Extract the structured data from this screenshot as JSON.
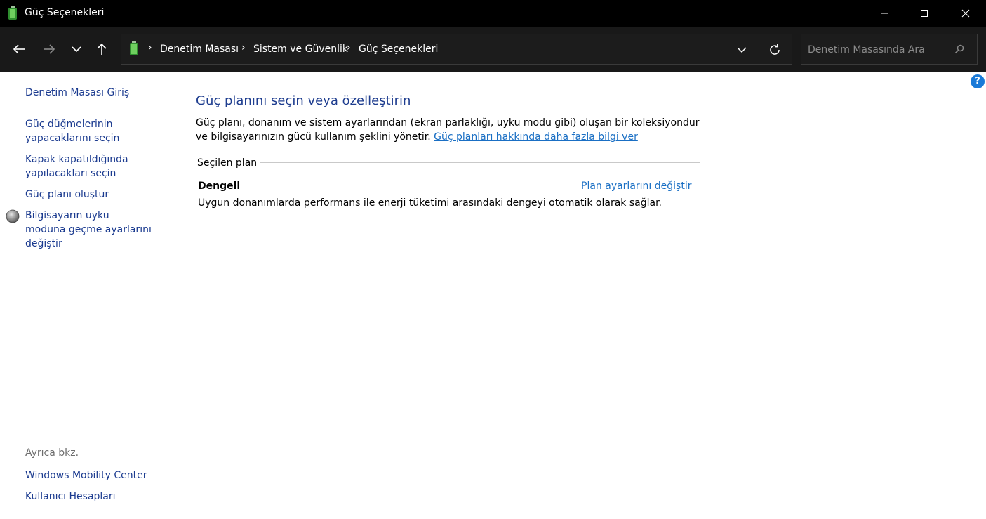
{
  "window": {
    "title": "Güç Seçenekleri"
  },
  "address_bar": {
    "breadcrumbs": [
      "Denetim Masası",
      "Sistem ve Güvenlik",
      "Güç Seçenekleri"
    ],
    "separator": "›"
  },
  "search": {
    "placeholder": "Denetim Masasında Ara"
  },
  "sidebar": {
    "home_link": "Denetim Masası Giriş",
    "tasks": [
      "Güç düğmelerinin yapacaklarını seçin",
      "Kapak kapatıldığında yapılacakları seçin",
      "Güç planı oluştur",
      "Bilgisayarın uyku moduna geçme ayarlarını değiştir"
    ],
    "see_also_label": "Ayrıca bkz.",
    "see_also": [
      "Windows Mobility Center",
      "Kullanıcı Hesapları"
    ]
  },
  "main": {
    "heading": "Güç planını seçin veya özelleştirin",
    "description": "Güç planı, donanım ve sistem ayarlarından (ekran parlaklığı, uyku modu gibi) oluşan bir koleksiyondur ve bilgisayarınızın gücü kullanım şeklini yönetir.",
    "learn_more_link": "Güç planları hakkında daha fazla bilgi ver",
    "selected_plan_label": "Seçilen plan",
    "plan": {
      "name": "Dengeli",
      "change_link": "Plan ayarlarını değiştir",
      "description": "Uygun donanımlarda performans ile enerji tüketimi arasındaki dengeyi otomatik olarak sağlar."
    }
  },
  "help": {
    "label": "?"
  },
  "colors": {
    "titlebar": "#000000",
    "navbar": "#191919",
    "link": "#1a6fc4",
    "heading": "#1e3d8f",
    "help": "#1a7ad8"
  }
}
